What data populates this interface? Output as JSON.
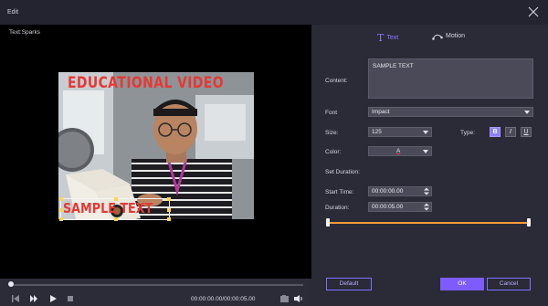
{
  "window": {
    "title": "Edit"
  },
  "preview": {
    "label": "Text:Sparks",
    "video_title": "EDUCATIONAL VIDEO",
    "overlay_text": "SAMPLE TEXT"
  },
  "player": {
    "timecode": "00:00:00.00/00:00:05.00",
    "progress": 0.0
  },
  "tabs": [
    {
      "label": "Text",
      "icon": "text-t-icon",
      "active": true
    },
    {
      "label": "Motion",
      "icon": "motion-path-icon",
      "active": false
    }
  ],
  "form": {
    "content_label": "Content:",
    "content_value": "SAMPLE TEXT",
    "font_label": "Font",
    "font_value": "Impact",
    "size_label": "Size:",
    "size_value": "125",
    "type_label": "Type:",
    "type_buttons": [
      "B",
      "I",
      "U"
    ],
    "color_label": "Color:",
    "color_value": "A",
    "set_duration_label": "Set Duration:",
    "start_label": "Start Time:",
    "start_value": "00:00:00.00",
    "duration_label": "Duration:",
    "duration_value": "00:00:05.00"
  },
  "buttons": {
    "default": "Default",
    "ok": "OK",
    "cancel": "Cancel"
  },
  "colors": {
    "accent": "#7c5cff",
    "timeline": "#ff9a3c",
    "overlay_text": "#e53935"
  }
}
